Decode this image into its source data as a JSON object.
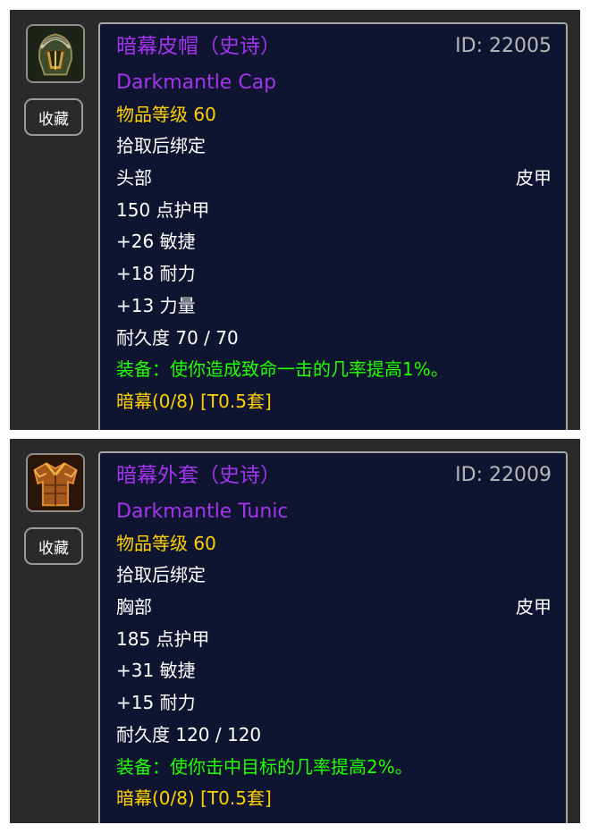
{
  "items": [
    {
      "fav_label": "收藏",
      "name_cn": "暗幕皮帽（史诗）",
      "id_text": "ID: 22005",
      "name_en": "Darkmantle Cap",
      "item_level": "物品等级 60",
      "bind": "拾取后绑定",
      "slot": "头部",
      "armor_type": "皮甲",
      "armor": "150 点护甲",
      "stats": [
        "+26 敏捷",
        "+18 耐力",
        "+13 力量"
      ],
      "durability": "耐久度 70 / 70",
      "equip_effect": "装备：使你造成致命一击的几率提高1%。",
      "set_name": "暗幕(0/8) [T0.5套]",
      "icon": "helmet-icon",
      "colors": {
        "epic": "#a335ee",
        "item_level": "#ffd100",
        "equip": "#1eff00",
        "tooltip_bg": "#0f1430"
      }
    },
    {
      "fav_label": "收藏",
      "name_cn": "暗幕外套（史诗）",
      "id_text": "ID: 22009",
      "name_en": "Darkmantle Tunic",
      "item_level": "物品等级 60",
      "bind": "拾取后绑定",
      "slot": "胸部",
      "armor_type": "皮甲",
      "armor": "185 点护甲",
      "stats": [
        "+31 敏捷",
        "+15 耐力"
      ],
      "durability": "耐久度 120 / 120",
      "equip_effect": "装备：使你击中目标的几率提高2%。",
      "set_name": "暗幕(0/8) [T0.5套]",
      "icon": "chest-armor-icon",
      "colors": {
        "epic": "#a335ee",
        "item_level": "#ffd100",
        "equip": "#1eff00",
        "tooltip_bg": "#0f1430"
      }
    }
  ]
}
